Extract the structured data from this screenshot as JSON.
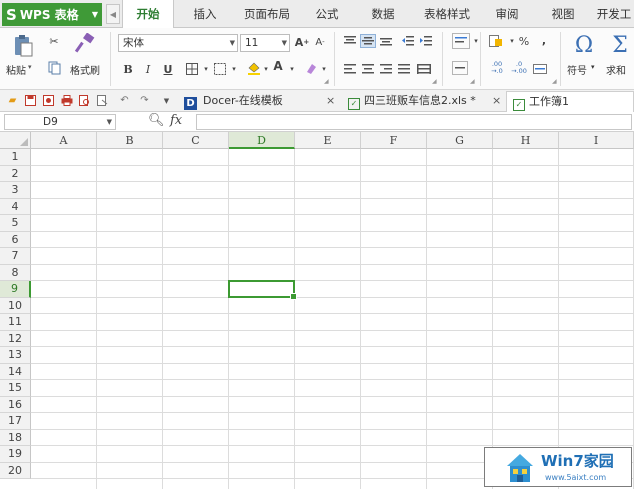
{
  "app": {
    "name": "WPS 表格",
    "logo_letter": "S"
  },
  "menu": {
    "tabs": [
      {
        "label": "开始",
        "active": true
      },
      {
        "label": "插入"
      },
      {
        "label": "页面布局"
      },
      {
        "label": "公式"
      },
      {
        "label": "数据"
      },
      {
        "label": "表格样式"
      },
      {
        "label": "审阅"
      },
      {
        "label": "视图"
      },
      {
        "label": "开发工"
      }
    ]
  },
  "ribbon": {
    "paste_label": "粘贴",
    "format_painter_label": "格式刷",
    "font_name": "宋体",
    "font_size": "11",
    "bold": "B",
    "italic": "I",
    "underline": "U",
    "percent": "%",
    "comma": ",",
    "dec_increase": ".00→.0",
    "dec_decrease": ".0→.00",
    "symbol_label": "符号",
    "sum_label": "求和",
    "omega": "Ω",
    "sigma": "Σ"
  },
  "documents": [
    {
      "label": "Docer-在线模板",
      "icon": "D"
    },
    {
      "label": "四三班贩车信息2.xls *"
    },
    {
      "label": "工作簿1",
      "active": true
    }
  ],
  "formula_bar": {
    "cell_ref": "D9",
    "fx": "fx",
    "value": ""
  },
  "grid": {
    "columns": [
      "A",
      "B",
      "C",
      "D",
      "E",
      "F",
      "G",
      "H",
      "I"
    ],
    "rows": [
      "1",
      "2",
      "3",
      "4",
      "5",
      "6",
      "7",
      "8",
      "9",
      "10",
      "11",
      "12",
      "13",
      "14",
      "15",
      "16",
      "17",
      "18",
      "19",
      "20"
    ],
    "active_column": "D",
    "active_row": "9"
  },
  "watermark": {
    "title": "Win7家园",
    "url": "www.5aixt.com"
  }
}
